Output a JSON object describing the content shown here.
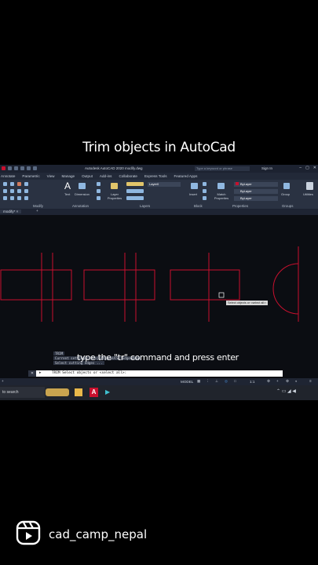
{
  "caption": "Trim objects in AutoCad",
  "app": {
    "title": "Autodesk AutoCAD 2020   modify.dwg",
    "search_placeholder": "Type a keyword or phrase",
    "sign_in": "Sign In",
    "tabs": [
      "Annotate",
      "Parametric",
      "View",
      "Manage",
      "Output",
      "Add-ins",
      "Collaborate",
      "Express Tools",
      "Featured Apps"
    ],
    "ribbon": {
      "modify_label": "Modify",
      "text_label": "Text",
      "dimension_label": "Dimension",
      "annotation_label": "Annotation",
      "layer_properties_label": "Layer Properties",
      "layer_name": "Layer0",
      "layers_label": "Layers",
      "insert_label": "Insert",
      "block_label": "Block",
      "match_properties_label": "Match Properties",
      "bylayer": "ByLayer",
      "properties_label": "Properties",
      "group_label": "Group",
      "groups_label": "Groups",
      "utilities_label": "Utilities"
    },
    "doc_tab": "modify*",
    "tooltip": "Select objects or <select all>:",
    "command_history": [
      "TRIM",
      "Current settings: Projection=UCS, Edge=None",
      "Select cutting edges ..."
    ],
    "command_line": "TRIM Select objects or <select all>:",
    "model_label": "MODEL",
    "scale": "1:1"
  },
  "overlay_instruction": "type the \"tr\" command and press enter",
  "taskbar": {
    "search_label": "to search"
  },
  "footer": {
    "account_name": "cad_camp_nepal",
    "icon": "reels-icon"
  },
  "colors": {
    "drawing_lines": "#c8102e",
    "background": "#000000"
  }
}
